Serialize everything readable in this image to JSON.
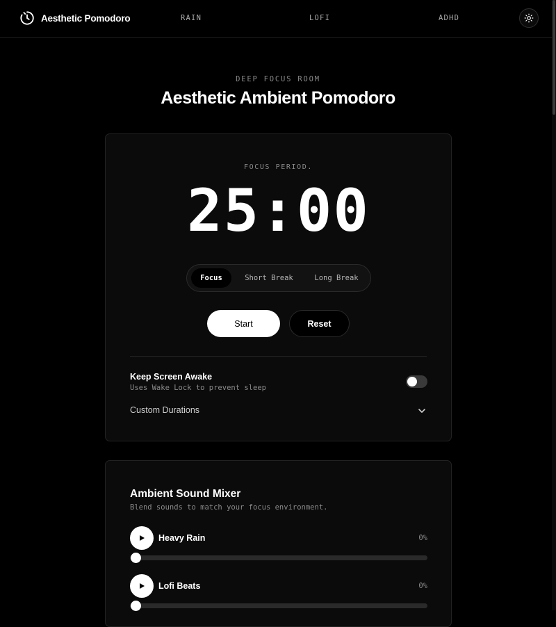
{
  "header": {
    "brand": "Aesthetic Pomodoro",
    "nav": [
      {
        "label": "RAIN"
      },
      {
        "label": "LOFI"
      },
      {
        "label": "ADHD"
      }
    ],
    "theme_icon": "sun-icon"
  },
  "hero": {
    "eyebrow": "DEEP FOCUS ROOM",
    "title": "Aesthetic Ambient Pomodoro"
  },
  "timer": {
    "period_label": "FOCUS PERIOD.",
    "display": "25:00",
    "modes": [
      {
        "label": "Focus",
        "active": true
      },
      {
        "label": "Short Break",
        "active": false
      },
      {
        "label": "Long Break",
        "active": false
      }
    ],
    "start_label": "Start",
    "reset_label": "Reset",
    "keep_awake": {
      "title": "Keep Screen Awake",
      "subtitle": "Uses Wake Lock to prevent sleep",
      "enabled": false
    },
    "custom_durations_label": "Custom Durations"
  },
  "mixer": {
    "title": "Ambient Sound Mixer",
    "subtitle": "Blend sounds to match your focus environment.",
    "tracks": [
      {
        "name": "Heavy Rain",
        "percent_label": "0%",
        "volume": 0
      },
      {
        "name": "Lofi Beats",
        "percent_label": "0%",
        "volume": 0
      }
    ]
  },
  "colors": {
    "background": "#000000",
    "card": "#0b0b0b",
    "accent": "#ffffff",
    "muted_text": "#8a8a8a"
  }
}
